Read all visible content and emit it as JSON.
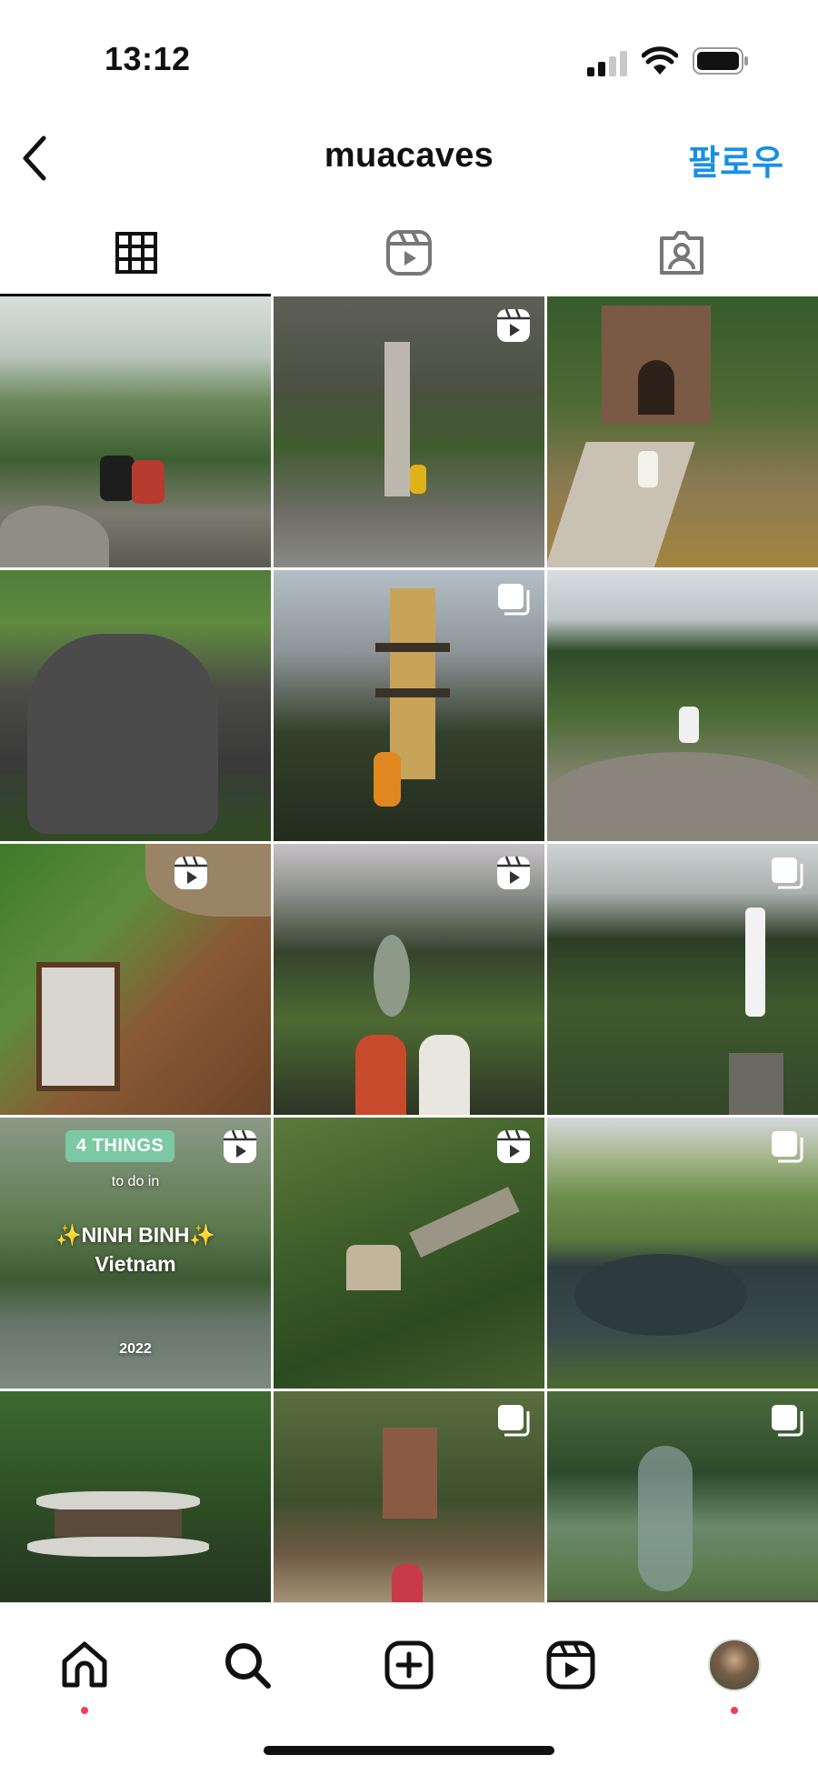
{
  "status_bar": {
    "time": "13:12",
    "signal_icon": "cellular-signal-icon",
    "wifi_icon": "wifi-icon",
    "battery_icon": "battery-icon"
  },
  "header": {
    "username": "muacaves",
    "follow_label": "팔로우",
    "back_icon": "chevron-left-icon"
  },
  "tabs": [
    {
      "name": "posts",
      "icon": "grid-icon",
      "active": true
    },
    {
      "name": "reels",
      "icon": "reels-icon",
      "active": false
    },
    {
      "name": "tagged",
      "icon": "tagged-person-icon",
      "active": false
    }
  ],
  "posts": [
    {
      "type": "photo"
    },
    {
      "type": "reel"
    },
    {
      "type": "photo"
    },
    {
      "type": "photo"
    },
    {
      "type": "carousel"
    },
    {
      "type": "photo"
    },
    {
      "type": "reel"
    },
    {
      "type": "reel"
    },
    {
      "type": "carousel"
    },
    {
      "type": "reel",
      "overlay": {
        "pill": "4 THINGS",
        "line1": "to do in",
        "line2": "✨NINH BINH✨",
        "line3": "Vietnam",
        "year": "2022"
      }
    },
    {
      "type": "reel"
    },
    {
      "type": "carousel"
    },
    {
      "type": "photo"
    },
    {
      "type": "carousel"
    },
    {
      "type": "carousel"
    }
  ],
  "bottom_nav": [
    {
      "name": "home",
      "icon": "home-icon",
      "notification_dot": true
    },
    {
      "name": "search",
      "icon": "search-icon",
      "notification_dot": false
    },
    {
      "name": "create",
      "icon": "plus-square-icon",
      "notification_dot": false
    },
    {
      "name": "reels",
      "icon": "reels-icon",
      "notification_dot": false
    },
    {
      "name": "profile",
      "icon": "profile-avatar",
      "notification_dot": true
    }
  ],
  "colors": {
    "accent": "#1a8fe3",
    "notification": "#ef3d5b",
    "text": "#111111"
  }
}
